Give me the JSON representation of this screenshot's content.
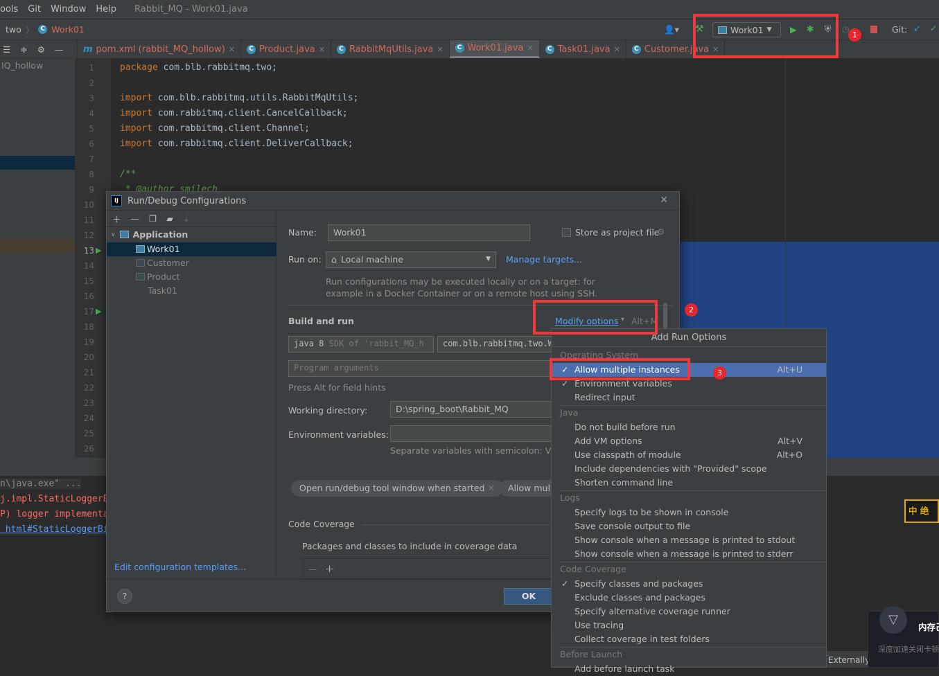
{
  "menubar": {
    "items": [
      "ools",
      "Git",
      "Window",
      "Help"
    ],
    "title": "Rabbit_MQ - Work01.java"
  },
  "navbar": {
    "crumbs": [
      "two",
      "Work01"
    ],
    "run_config": "Work01",
    "git_label": "Git:"
  },
  "tabs": [
    {
      "label": "pom.xml (rabbit_MQ_hollow)",
      "icon": "maven-icon"
    },
    {
      "label": "Product.java"
    },
    {
      "label": "RabbitMqUtils.java"
    },
    {
      "label": "Work01.java",
      "active": true
    },
    {
      "label": "Task01.java"
    },
    {
      "label": "Customer.java"
    }
  ],
  "project": {
    "root": "IQ_hollow"
  },
  "editor": {
    "lines": [
      {
        "n": "1",
        "kw": "package",
        "rest": " com.blb.rabbitmq.two;"
      },
      {
        "n": "2"
      },
      {
        "n": "3",
        "kw": "import",
        "rest": " com.blb.rabbitmq.utils.RabbitMqUtils;"
      },
      {
        "n": "4",
        "kw": "import",
        "rest": " com.rabbitmq.client.CancelCallback;"
      },
      {
        "n": "5",
        "kw": "import",
        "rest": " com.rabbitmq.client.Channel;"
      },
      {
        "n": "6",
        "kw": "import",
        "rest": " com.rabbitmq.client.DeliverCallback;"
      },
      {
        "n": "7"
      },
      {
        "n": "8",
        "cm": "/**"
      },
      {
        "n": "9",
        "cm": " * @author smilech"
      },
      {
        "n": "10"
      },
      {
        "n": "11"
      },
      {
        "n": "12"
      },
      {
        "n": "13"
      },
      {
        "n": "14"
      },
      {
        "n": "15"
      },
      {
        "n": "16"
      },
      {
        "n": "17"
      },
      {
        "n": "18"
      },
      {
        "n": "19"
      },
      {
        "n": "20"
      },
      {
        "n": "21"
      },
      {
        "n": "22"
      },
      {
        "n": "23"
      },
      {
        "n": "24"
      },
      {
        "n": "25"
      },
      {
        "n": "26"
      }
    ]
  },
  "console": {
    "lines": [
      {
        "text": "n\\java.exe\" ...",
        "color": "#8a8a8a"
      },
      {
        "text": "j.impl.StaticLoggerB",
        "color": "#ff6b68"
      },
      {
        "text": "P) logger implementa",
        "color": "#ff6b68"
      },
      {
        "text": " html#StaticLoggerBi",
        "color": "#589df6"
      }
    ],
    "status": "Externally added files can b"
  },
  "dialog": {
    "title": "Run/Debug Configurations",
    "tree": {
      "group": "Application",
      "items": [
        "Work01",
        "Customer",
        "Product",
        "Task01"
      ],
      "selected": "Work01"
    },
    "edit_templates": "Edit configuration templates...",
    "name_label": "Name:",
    "name_value": "Work01",
    "store_label": "Store as project file",
    "run_on_label": "Run on:",
    "run_on_value": "Local machine",
    "manage_targets": "Manage targets...",
    "run_on_hint_1": "Run configurations may be executed locally or on a target: for",
    "run_on_hint_2": "example in a Docker Container or on a remote host using SSH.",
    "build_run": "Build and run",
    "modify_options": "Modify options",
    "modify_shortcut": "Alt+M",
    "sdk_bold": "java 8",
    "sdk_rest": " SDK of 'rabbit_MQ_h",
    "main_class": "com.blb.rabbitmq.two.Wo",
    "program_args_placeholder": "Program arguments",
    "field_hints": "Press Alt for field hints",
    "working_dir_label": "Working directory:",
    "working_dir_value": "D:\\spring_boot\\Rabbit_MQ",
    "env_label": "Environment variables:",
    "env_hint": "Separate variables with semicolon: VAR",
    "chips": [
      "Open run/debug tool window when started",
      "Allow multi"
    ],
    "code_coverage": "Code Coverage",
    "packages_label": "Packages and classes to include in coverage data",
    "ok": "OK"
  },
  "popup": {
    "title": "Add Run Options",
    "groups": [
      {
        "name": "Operating System",
        "items": [
          {
            "label": "Allow multiple instances",
            "checked": true,
            "shortcut": "Alt+U",
            "selected": true
          },
          {
            "label": "Environment variables",
            "checked": true
          },
          {
            "label": "Redirect input"
          }
        ]
      },
      {
        "name": "Java",
        "items": [
          {
            "label": "Do not build before run"
          },
          {
            "label": "Add VM options",
            "shortcut": "Alt+V"
          },
          {
            "label": "Use classpath of module",
            "shortcut": "Alt+O"
          },
          {
            "label": "Include dependencies with \"Provided\" scope"
          },
          {
            "label": "Shorten command line"
          }
        ]
      },
      {
        "name": "Logs",
        "items": [
          {
            "label": "Specify logs to be shown in console"
          },
          {
            "label": "Save console output to file"
          },
          {
            "label": "Show console when a message is printed to stdout"
          },
          {
            "label": "Show console when a message is printed to stderr"
          }
        ]
      },
      {
        "name": "Code Coverage",
        "items": [
          {
            "label": "Specify classes and packages",
            "checked": true
          },
          {
            "label": "Exclude classes and packages"
          },
          {
            "label": "Specify alternative coverage runner"
          },
          {
            "label": "Use tracing"
          },
          {
            "label": "Collect coverage in test folders"
          }
        ]
      },
      {
        "name": "Before Launch",
        "items": [
          {
            "label": "Add before launch task"
          }
        ]
      }
    ]
  },
  "annotations": [
    "1",
    "2",
    "3"
  ],
  "notification": {
    "title": "内存己",
    "body": "深度加速关闭卡顿"
  },
  "colors": {
    "accent": "#4b6eaf",
    "highlight_red": "#f0373a",
    "link": "#589df6"
  }
}
